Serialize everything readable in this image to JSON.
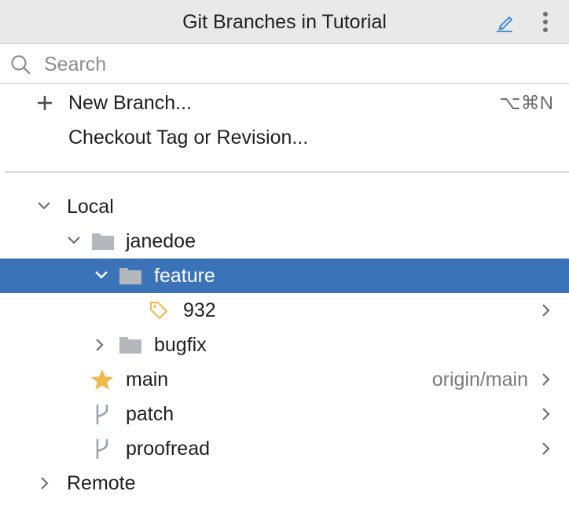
{
  "header": {
    "title": "Git Branches in Tutorial"
  },
  "search": {
    "placeholder": "Search",
    "value": ""
  },
  "actions": {
    "new_branch_label": "New Branch...",
    "new_branch_shortcut": "⌥⌘N",
    "checkout_label": "Checkout Tag or Revision..."
  },
  "tree": {
    "local_label": "Local",
    "janedoe_label": "janedoe",
    "feature_label": "feature",
    "branch_932_label": "932",
    "bugfix_label": "bugfix",
    "main_label": "main",
    "main_tracking": "origin/main",
    "patch_label": "patch",
    "proofread_label": "proofread",
    "remote_label": "Remote"
  },
  "colors": {
    "selection": "#3b73b9",
    "accent_blue": "#4b8fd8",
    "star": "#f0b849",
    "folder": "#b4b8bd"
  },
  "icons": {
    "edit": "edit-pencil-icon",
    "more": "more-vertical-icon",
    "search": "search-icon",
    "plus": "plus-icon",
    "folder": "folder-icon",
    "tag": "tag-icon",
    "star": "star-icon",
    "branch": "git-branch-icon"
  }
}
